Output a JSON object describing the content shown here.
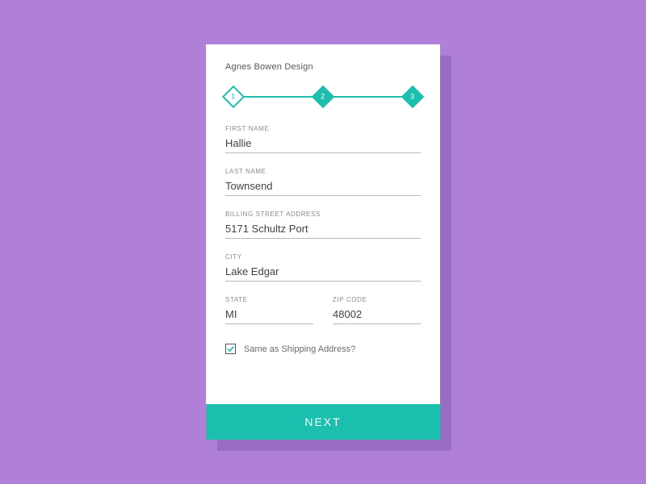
{
  "brand": "Agnes Bowen Design",
  "stepper": {
    "steps": [
      {
        "number": "1",
        "active": true
      },
      {
        "number": "2",
        "active": false
      },
      {
        "number": "3",
        "active": false
      }
    ]
  },
  "fields": {
    "first_name": {
      "label": "FIRST NAME",
      "value": "Hallie"
    },
    "last_name": {
      "label": "LAST NAME",
      "value": "Townsend"
    },
    "billing_street": {
      "label": "BILLING STREET ADDRESS",
      "value": "5171 Schultz Port"
    },
    "city": {
      "label": "CITY",
      "value": "Lake Edgar"
    },
    "state": {
      "label": "STATE",
      "value": "MI"
    },
    "zip": {
      "label": "ZIP CODE",
      "value": "48002"
    }
  },
  "checkbox": {
    "label": "Same as Shipping Address?",
    "checked": true
  },
  "actions": {
    "next": "NEXT"
  },
  "colors": {
    "background": "#b07fd8",
    "shadow": "#9a6dc5",
    "accent": "#1cbfae"
  }
}
